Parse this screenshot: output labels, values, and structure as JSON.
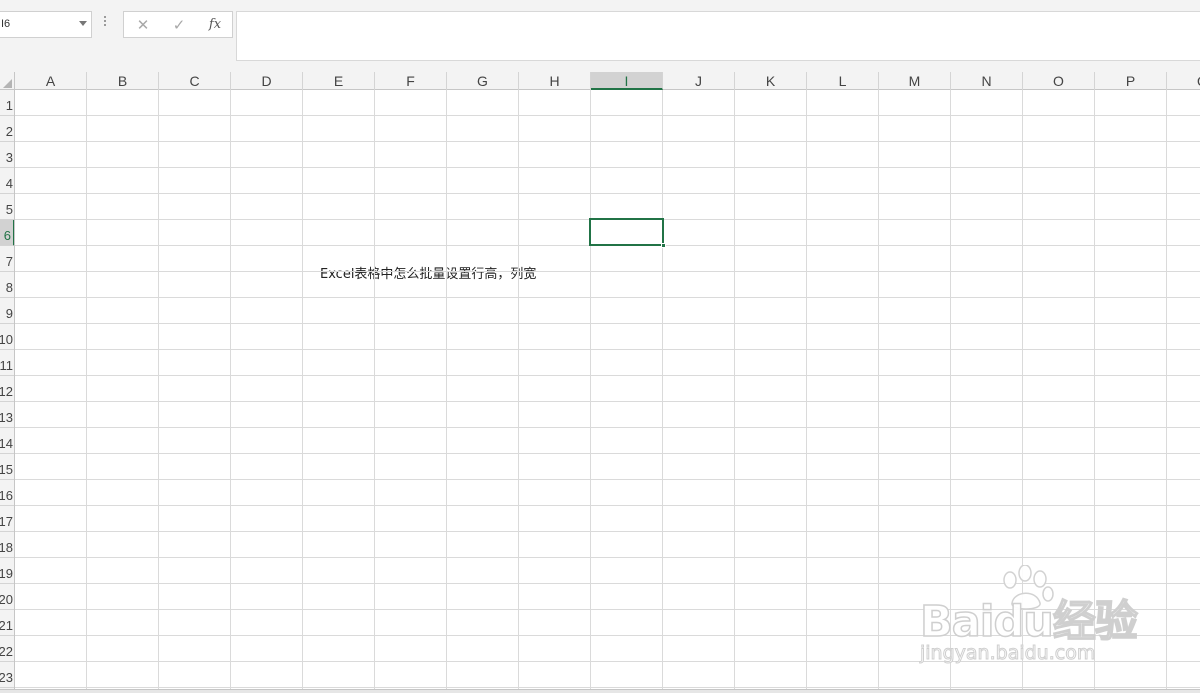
{
  "formula_bar": {
    "name_box": "I6",
    "cancel_symbol": "✕",
    "enter_symbol": "✓",
    "fx_symbol": "fx",
    "formula_value": ""
  },
  "grid": {
    "columns": [
      "A",
      "B",
      "C",
      "D",
      "E",
      "F",
      "G",
      "H",
      "I",
      "J",
      "K",
      "L",
      "M",
      "N",
      "O",
      "P",
      "Q"
    ],
    "rows": [
      "1",
      "2",
      "3",
      "4",
      "5",
      "6",
      "7",
      "8",
      "9",
      "10",
      "11",
      "12",
      "13",
      "14",
      "15",
      "16",
      "17",
      "18",
      "19",
      "20",
      "21",
      "22",
      "23"
    ],
    "active_column": "I",
    "active_row": "6",
    "cell_E4": "Excel表格中怎么批量设置行高，列宽"
  },
  "watermark": {
    "brand": "Baidu经验",
    "url": "jingyan.baidu.com"
  },
  "colors": {
    "accent": "#217346",
    "gridline": "#dadada",
    "header_bg": "#f3f3f3"
  }
}
